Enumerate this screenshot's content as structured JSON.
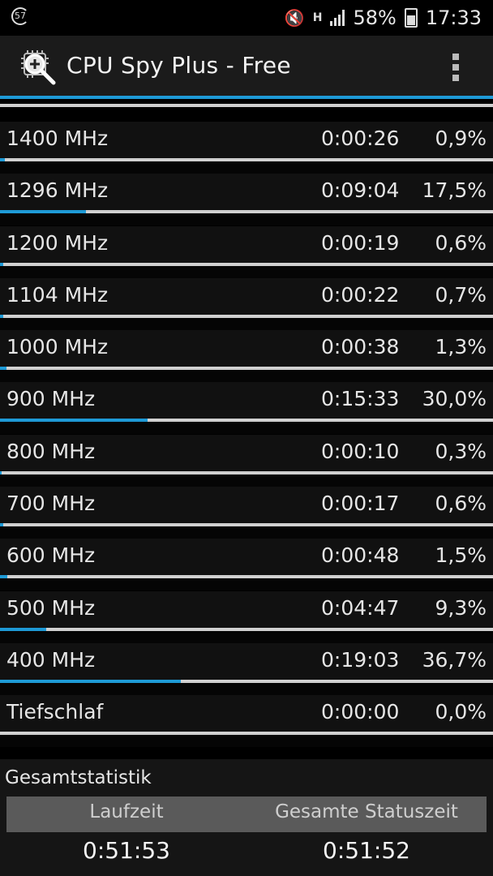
{
  "status_bar": {
    "notification_badge": "57",
    "mute_icon": "mute-icon",
    "network_label": "H",
    "battery_percent": "58%",
    "clock": "17:33"
  },
  "app_bar": {
    "title": "CPU Spy Plus - Free",
    "logo_icon": "cpu-magnifier-icon",
    "menu_icon": "overflow-menu-icon",
    "accent_color": "#1e9ad6"
  },
  "states": [
    {
      "label": "1400 MHz",
      "time": "0:00:26",
      "percent": "0,9%",
      "fraction": 0.009
    },
    {
      "label": "1296 MHz",
      "time": "0:09:04",
      "percent": "17,5%",
      "fraction": 0.175
    },
    {
      "label": "1200 MHz",
      "time": "0:00:19",
      "percent": "0,6%",
      "fraction": 0.006
    },
    {
      "label": "1104 MHz",
      "time": "0:00:22",
      "percent": "0,7%",
      "fraction": 0.007
    },
    {
      "label": "1000 MHz",
      "time": "0:00:38",
      "percent": "1,3%",
      "fraction": 0.013
    },
    {
      "label": "900 MHz",
      "time": "0:15:33",
      "percent": "30,0%",
      "fraction": 0.3
    },
    {
      "label": "800 MHz",
      "time": "0:00:10",
      "percent": "0,3%",
      "fraction": 0.003
    },
    {
      "label": "700 MHz",
      "time": "0:00:17",
      "percent": "0,6%",
      "fraction": 0.006
    },
    {
      "label": "600 MHz",
      "time": "0:00:48",
      "percent": "1,5%",
      "fraction": 0.015
    },
    {
      "label": "500 MHz",
      "time": "0:04:47",
      "percent": "9,3%",
      "fraction": 0.093
    },
    {
      "label": "400 MHz",
      "time": "0:19:03",
      "percent": "36,7%",
      "fraction": 0.367
    },
    {
      "label": "Tiefschlaf",
      "time": "0:00:00",
      "percent": "0,0%",
      "fraction": 0.0
    }
  ],
  "totals": {
    "title": "Gesamtstatistik",
    "col1_label": "Laufzeit",
    "col2_label": "Gesamte Statuszeit",
    "col1_value": "0:51:53",
    "col2_value": "0:51:52"
  }
}
